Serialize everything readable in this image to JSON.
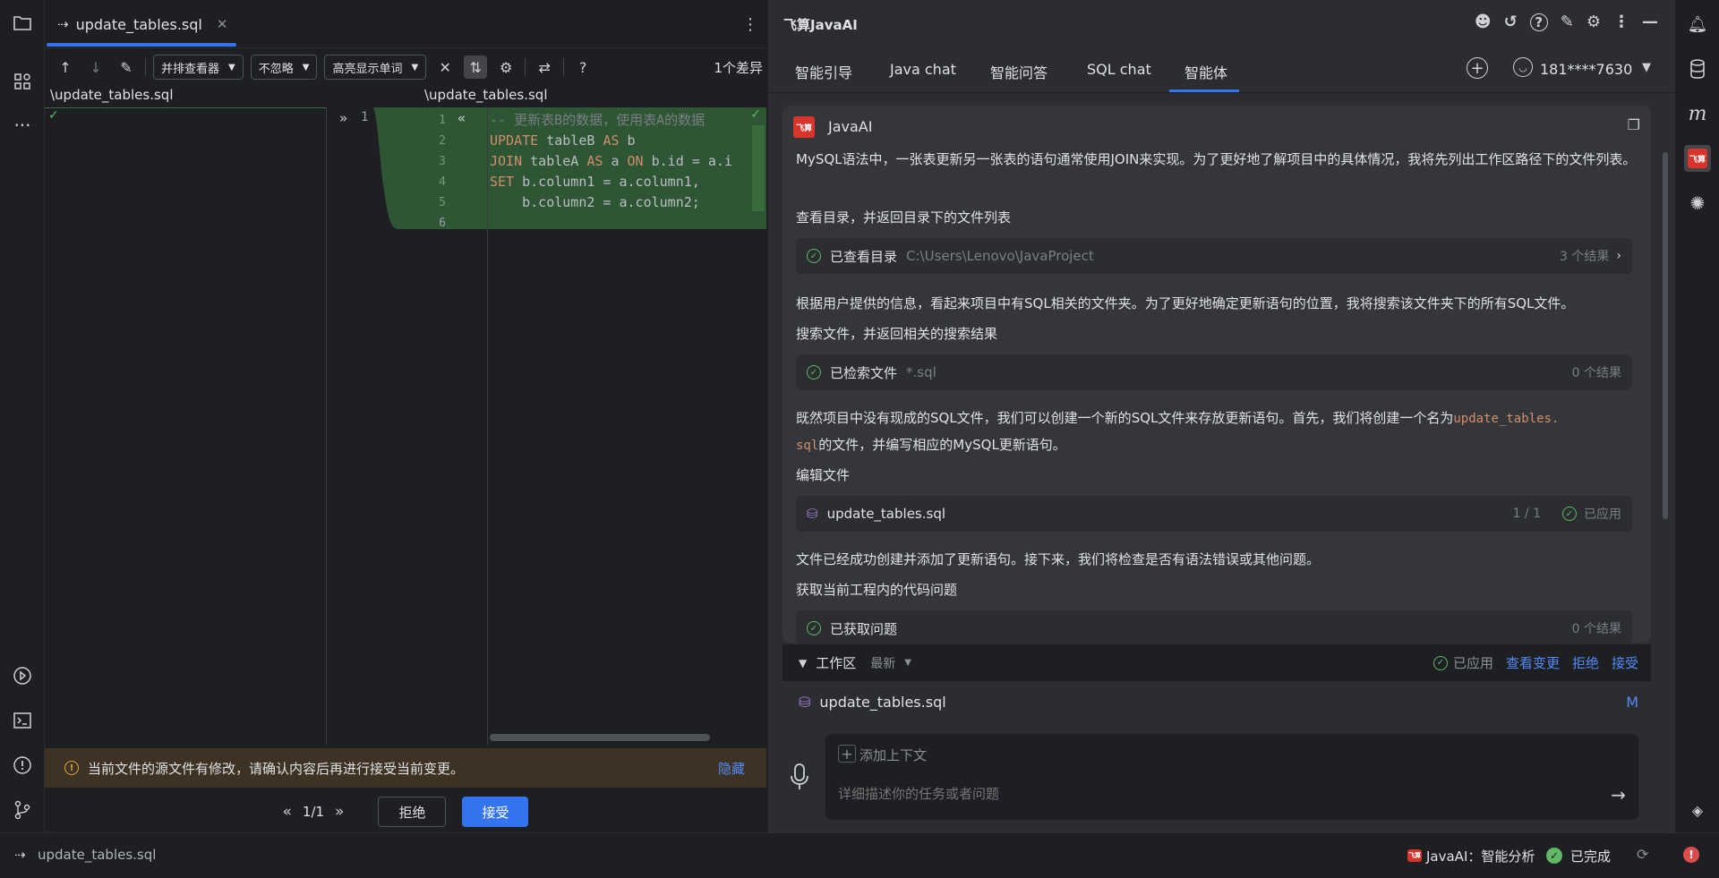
{
  "editor": {
    "tab_label": "update_tables.sql",
    "toolbar": {
      "viewer_select": "并排查看器",
      "ignore_select": "不忽略",
      "highlight_select": "高亮显示单词",
      "diff_count": "1个差异"
    },
    "left_path": "\\update_tables.sql",
    "right_path": "\\update_tables.sql",
    "left_line": "1",
    "lines": [
      {
        "no": "1",
        "parts": [
          {
            "t": "-- 更新表B的数据，使用表A的数据",
            "c": "cmt"
          }
        ]
      },
      {
        "no": "2",
        "parts": [
          {
            "t": "UPDATE",
            "c": "kw"
          },
          {
            "t": " tableB ",
            "c": "code"
          },
          {
            "t": "AS",
            "c": "kw"
          },
          {
            "t": " b",
            "c": "code"
          }
        ]
      },
      {
        "no": "3",
        "parts": [
          {
            "t": "JOIN",
            "c": "kw"
          },
          {
            "t": " tableA ",
            "c": "code"
          },
          {
            "t": "AS",
            "c": "kw"
          },
          {
            "t": " a ",
            "c": "code"
          },
          {
            "t": "ON",
            "c": "kw"
          },
          {
            "t": " b.id = a.i",
            "c": "code"
          }
        ]
      },
      {
        "no": "4",
        "parts": [
          {
            "t": "SET",
            "c": "kw"
          },
          {
            "t": " b.column1 = a.column1,",
            "c": "code"
          }
        ]
      },
      {
        "no": "5",
        "parts": [
          {
            "t": "    b.column2 = a.column2;",
            "c": "code"
          }
        ]
      },
      {
        "no": "6",
        "parts": []
      }
    ],
    "banner_text": "当前文件的源文件有修改，请确认内容后再进行接受当前变更。",
    "banner_hide": "隐藏",
    "pager": "1/1",
    "reject_label": "拒绝",
    "accept_label": "接受"
  },
  "ai": {
    "title": "飞算JavaAI",
    "tabs": [
      "智能引导",
      "Java chat",
      "智能问答",
      "SQL chat",
      "智能体"
    ],
    "user": "181****7630",
    "sender": "JavaAI",
    "logo_text": "飞算",
    "messages": {
      "p1": "MySQL语法中，一张表更新另一张表的语句通常使用JOIN来实现。为了更好地了解项目中的具体情况，我将先列出工作区路径下的文件列表。",
      "s1": "查看目录，并返回目录下的文件列表",
      "t1_label": "已查看目录",
      "t1_meta": "C:\\Users\\Lenovo\\JavaProject",
      "t1_count": "3 个结果",
      "p2": "根据用户提供的信息，看起来项目中有SQL相关的文件夹。为了更好地确定更新语句的位置，我将搜索该文件夹下的所有SQL文件。",
      "s2": "搜索文件，并返回相关的搜索结果",
      "t2_label": "已检索文件",
      "t2_meta": "*.sql",
      "t2_count": "0 个结果",
      "p3_a": "既然项目中没有现成的SQL文件，我们可以创建一个新的SQL文件来存放更新语句。首先，我们将创建一个名为",
      "p3_code1": "update_tables.",
      "p3_code2": "sql",
      "p3_b": "的文件，并编写相应的MySQL更新语句。",
      "s3": "编辑文件",
      "t3_label": "update_tables.sql",
      "t3_count": "1 / 1",
      "t3_status": "已应用",
      "p4": "文件已经成功创建并添加了更新语句。接下来，我们将检查是否有语法错误或其他问题。",
      "s4": "获取当前工程内的代码问题",
      "t4_label": "已获取问题",
      "t4_count": "0 个结果"
    },
    "workspace": {
      "label": "工作区",
      "filter": "最新",
      "applied": "已应用",
      "view_changes": "查看变更",
      "reject": "拒绝",
      "accept": "接受",
      "file": "update_tables.sql",
      "file_status": "M"
    },
    "input": {
      "add_context": "添加上下文",
      "placeholder": "详细描述你的任务或者问题"
    }
  },
  "status": {
    "file": "update_tables.sql",
    "task": "JavaAI：智能分析",
    "done": "已完成"
  }
}
